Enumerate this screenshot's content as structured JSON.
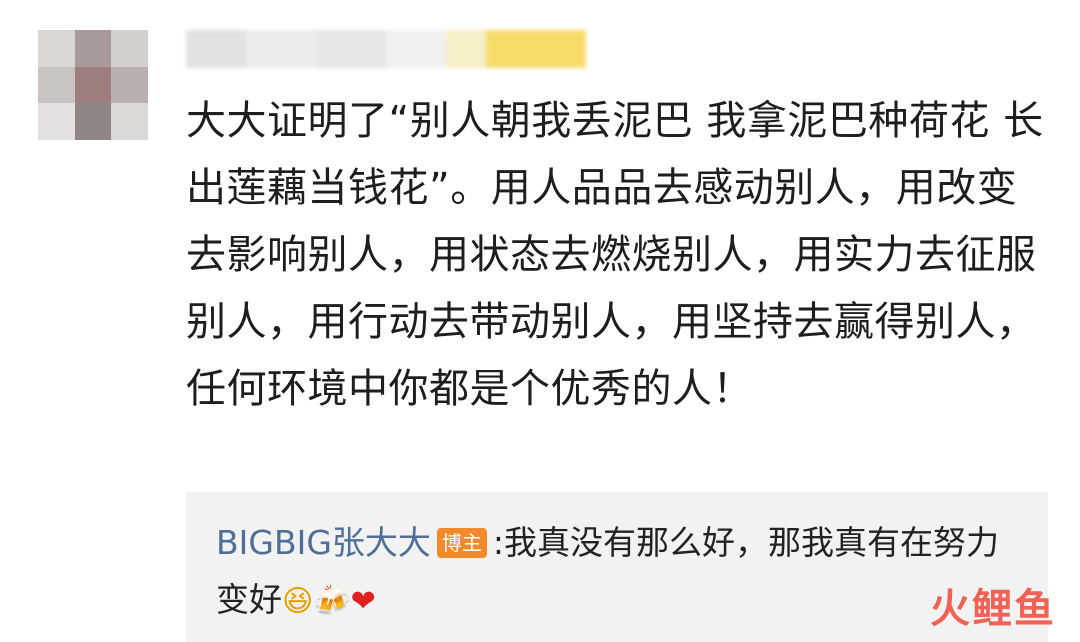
{
  "comment": {
    "text": "大大证明了“别人朝我丢泥巴 我拿泥巴种荷花 长出莲藕当钱花”。用人品品去感动别人，用改变去影响别人，用状态去燃烧别人，用实力去征服别人，用行动去带动别人，用坚持去赢得别人，任何环境中你都是个优秀的人！"
  },
  "reply": {
    "author": "BIGBIG张大大",
    "badge": "博主",
    "separator": ":",
    "text": "我真没有那么好，那我真有在努力变好",
    "emojis": [
      "laughing-face-icon",
      "beer-mugs-icon",
      "red-heart-icon"
    ]
  },
  "watermark": {
    "text": "火鲤鱼"
  },
  "colors": {
    "author_link": "#4f6f98",
    "badge_bg": "#f08a2c",
    "reply_bg": "#f2f2f2",
    "watermark": "#f04a3a"
  }
}
